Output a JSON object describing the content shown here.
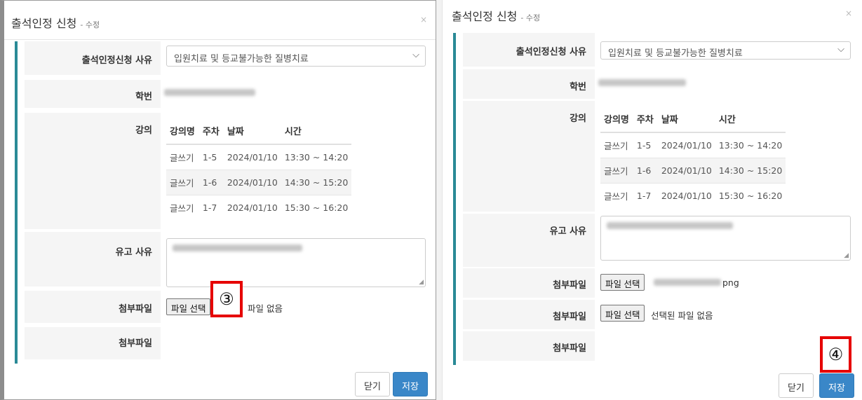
{
  "left_modal": {
    "title": "출석인정 신청",
    "subtitle": "- 수정",
    "close_glyph": "×",
    "reason_label": "출석인정신청 사유",
    "reason_value": "입원치료 및 등교불가능한 질병치료",
    "student_id_label": "학번",
    "lecture_label": "강의",
    "lecture_headers": [
      "강의명",
      "주차",
      "날짜",
      "시간"
    ],
    "lectures": [
      {
        "name": "글쓰기",
        "week": "1-5",
        "date": "2024/01/10",
        "time": "13:30 ~ 14:20"
      },
      {
        "name": "글쓰기",
        "week": "1-6",
        "date": "2024/01/10",
        "time": "14:30 ~ 15:20"
      },
      {
        "name": "글쓰기",
        "week": "1-7",
        "date": "2024/01/10",
        "time": "15:30 ~ 16:20"
      }
    ],
    "absence_reason_label": "유고 사유",
    "attach1_label": "첨부파일",
    "file_button": "파일 선택",
    "attach1_status": "파일 없음",
    "attach2_label": "첨부파일",
    "marker": "③",
    "close_button": "닫기",
    "save_button": "저장"
  },
  "right_modal": {
    "title": "출석인정 신청",
    "subtitle": "- 수정",
    "close_glyph": "×",
    "reason_label": "출석인정신청 사유",
    "reason_value": "입원치료 및 등교불가능한 질병치료",
    "student_id_label": "학번",
    "lecture_label": "강의",
    "lecture_headers": [
      "강의명",
      "주차",
      "날짜",
      "시간"
    ],
    "lectures": [
      {
        "name": "글쓰기",
        "week": "1-5",
        "date": "2024/01/10",
        "time": "13:30 ~ 14:20"
      },
      {
        "name": "글쓰기",
        "week": "1-6",
        "date": "2024/01/10",
        "time": "14:30 ~ 15:20"
      },
      {
        "name": "글쓰기",
        "week": "1-7",
        "date": "2024/01/10",
        "time": "15:30 ~ 16:20"
      }
    ],
    "absence_reason_label": "유고 사유",
    "attach1_label": "첨부파일",
    "file_button": "파일 선택",
    "attach1_status": "png",
    "attach2_label": "첨부파일",
    "attach2_status": "선택된 파일 없음",
    "attach3_label": "첨부파일",
    "marker": "④",
    "close_button": "닫기",
    "save_button": "저장"
  },
  "colors": {
    "panel_accent": "#2a8a96",
    "save_button": "#3a87c8",
    "marker_border": "#e60000"
  }
}
